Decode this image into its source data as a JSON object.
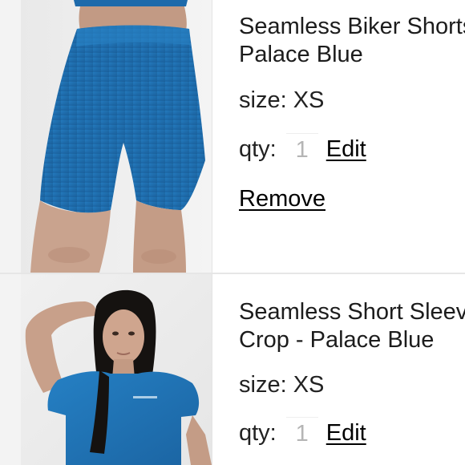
{
  "cart_items": [
    {
      "title": "Seamless Biker Shorts -\nPalace Blue",
      "size_label": "size:",
      "size_value": "XS",
      "qty_label": "qty:",
      "qty_value": "1",
      "edit_label": "Edit",
      "remove_label": "Remove",
      "image_alt": "blue biker shorts product photo"
    },
    {
      "title": "Seamless Short Sleeve\nCrop - Palace Blue",
      "size_label": "size:",
      "size_value": "XS",
      "qty_label": "qty:",
      "qty_value": "1",
      "edit_label": "Edit",
      "image_alt": "blue short sleeve crop top product photo"
    }
  ],
  "colors": {
    "product_blue": "#1f6fb2",
    "text": "#1c1c1c",
    "muted_qty": "#b5b5b5",
    "background": "#f1f1f1"
  }
}
